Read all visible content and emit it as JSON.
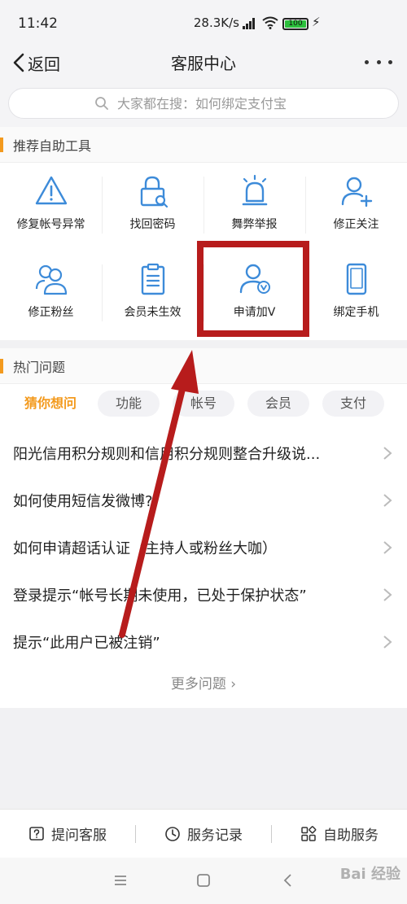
{
  "status_bar": {
    "time": "11:42",
    "network_speed": "28.3K/s",
    "battery": "100"
  },
  "nav": {
    "back_label": "返回",
    "title": "客服中心"
  },
  "search": {
    "placeholder": "大家都在搜：如何绑定支付宝"
  },
  "tools_section": {
    "title": "推荐自助工具",
    "items": [
      {
        "label": "修复帐号异常",
        "icon": "warning-icon"
      },
      {
        "label": "找回密码",
        "icon": "lock-search-icon"
      },
      {
        "label": "舞弊举报",
        "icon": "alarm-icon"
      },
      {
        "label": "修正关注",
        "icon": "user-add-icon"
      },
      {
        "label": "修正粉丝",
        "icon": "users-icon"
      },
      {
        "label": "会员未生效",
        "icon": "clipboard-icon"
      },
      {
        "label": "申请加V",
        "icon": "user-verified-icon"
      },
      {
        "label": "绑定手机",
        "icon": "phone-icon"
      }
    ]
  },
  "hot_section": {
    "title": "热门问题",
    "tabs": [
      {
        "label": "猜你想问",
        "active": true
      },
      {
        "label": "功能",
        "active": false
      },
      {
        "label": "帐号",
        "active": false
      },
      {
        "label": "会员",
        "active": false
      },
      {
        "label": "支付",
        "active": false
      }
    ],
    "questions": [
      "阳光信用积分规则和信用积分规则整合升级说...",
      "如何使用短信发微博?",
      "如何申请超话认证（主持人或粉丝大咖）",
      "登录提示“帐号长期未使用，已处于保护状态”",
      "提示“此用户已被注销”"
    ],
    "more_label": "更多问题"
  },
  "bottom_bar": {
    "ask_label": "提问客服",
    "records_label": "服务记录",
    "self_service_label": "自助服务"
  },
  "watermark": "Bai 经验",
  "colors": {
    "accent": "#f39a1e",
    "icon_blue": "#3d8bd9",
    "highlight_red": "#b71c1c"
  }
}
